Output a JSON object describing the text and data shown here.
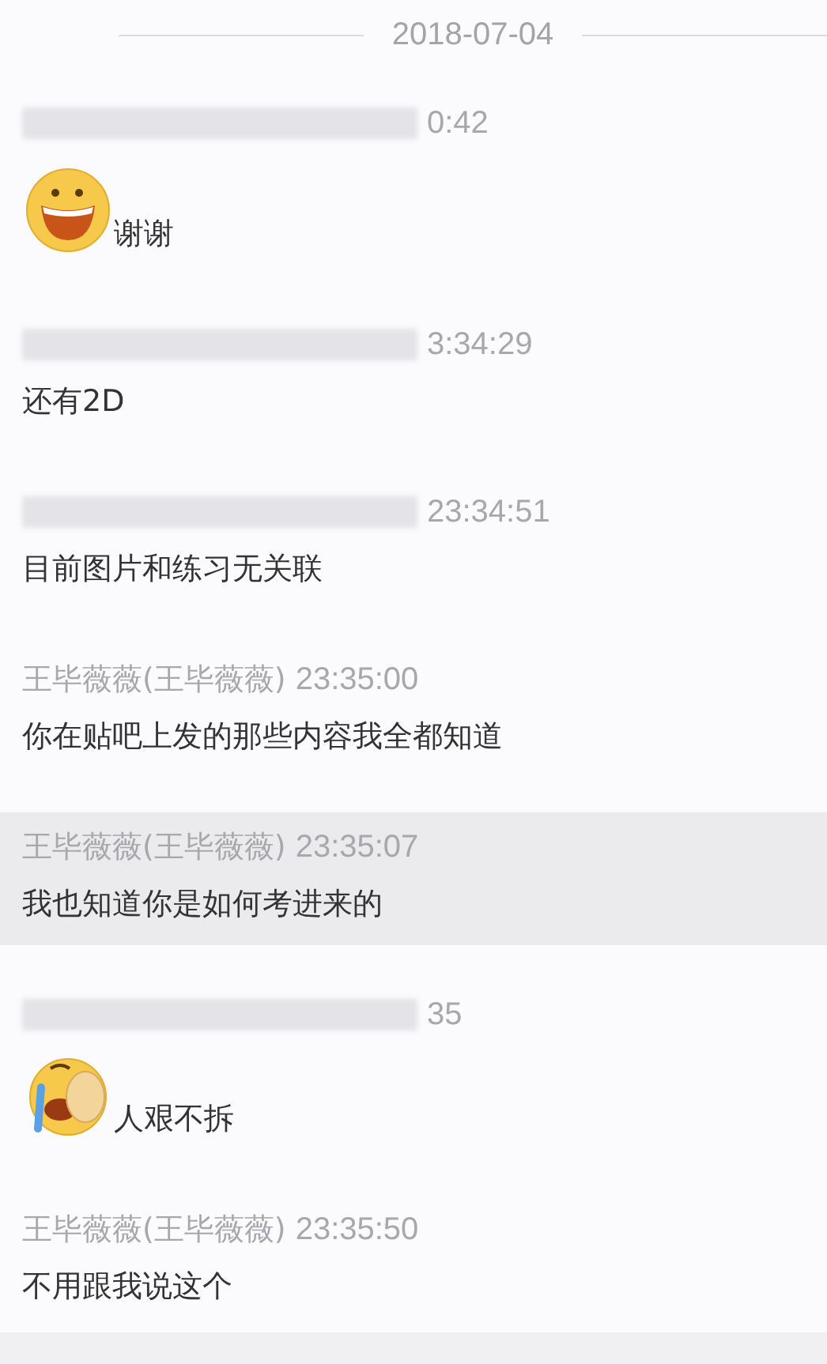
{
  "date": "2018-07-04",
  "messages": [
    {
      "blurred": true,
      "time": "0:42",
      "kind": "grin",
      "text": "谢谢",
      "selected": false
    },
    {
      "blurred": true,
      "time": "3:34:29",
      "kind": "text",
      "text": "还有2D",
      "selected": false
    },
    {
      "blurred": true,
      "time": "23:34:51",
      "kind": "text",
      "text": "目前图片和练习无关联",
      "selected": false
    },
    {
      "blurred": false,
      "name": "王毕薇薇(王毕薇薇)",
      "time": "23:35:00",
      "kind": "text",
      "text": "你在贴吧上发的那些内容我全都知道",
      "selected": false
    },
    {
      "blurred": false,
      "name": "王毕薇薇(王毕薇薇)",
      "time": "23:35:07",
      "kind": "text",
      "text": "我也知道你是如何考进来的",
      "selected": true
    },
    {
      "blurred": true,
      "time": "35",
      "kind": "cry",
      "text": "人艰不拆",
      "selected": false
    },
    {
      "blurred": false,
      "name": "王毕薇薇(王毕薇薇)",
      "time": "23:35:50",
      "kind": "text",
      "text": "不用跟我说这个",
      "selected": false
    }
  ]
}
